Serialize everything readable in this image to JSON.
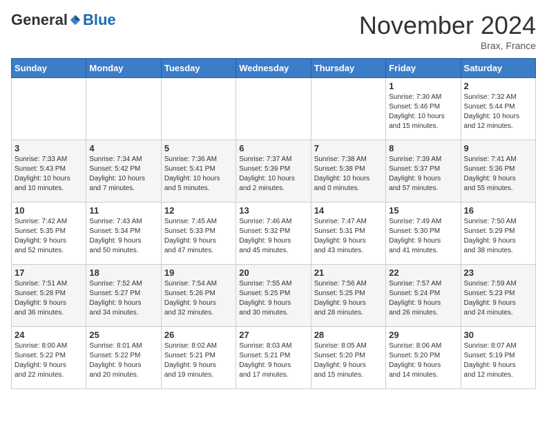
{
  "logo": {
    "general": "General",
    "blue": "Blue"
  },
  "title": "November 2024",
  "location": "Brax, France",
  "days_of_week": [
    "Sunday",
    "Monday",
    "Tuesday",
    "Wednesday",
    "Thursday",
    "Friday",
    "Saturday"
  ],
  "weeks": [
    [
      {
        "day": "",
        "info": ""
      },
      {
        "day": "",
        "info": ""
      },
      {
        "day": "",
        "info": ""
      },
      {
        "day": "",
        "info": ""
      },
      {
        "day": "",
        "info": ""
      },
      {
        "day": "1",
        "info": "Sunrise: 7:30 AM\nSunset: 5:46 PM\nDaylight: 10 hours\nand 15 minutes."
      },
      {
        "day": "2",
        "info": "Sunrise: 7:32 AM\nSunset: 5:44 PM\nDaylight: 10 hours\nand 12 minutes."
      }
    ],
    [
      {
        "day": "3",
        "info": "Sunrise: 7:33 AM\nSunset: 5:43 PM\nDaylight: 10 hours\nand 10 minutes."
      },
      {
        "day": "4",
        "info": "Sunrise: 7:34 AM\nSunset: 5:42 PM\nDaylight: 10 hours\nand 7 minutes."
      },
      {
        "day": "5",
        "info": "Sunrise: 7:36 AM\nSunset: 5:41 PM\nDaylight: 10 hours\nand 5 minutes."
      },
      {
        "day": "6",
        "info": "Sunrise: 7:37 AM\nSunset: 5:39 PM\nDaylight: 10 hours\nand 2 minutes."
      },
      {
        "day": "7",
        "info": "Sunrise: 7:38 AM\nSunset: 5:38 PM\nDaylight: 10 hours\nand 0 minutes."
      },
      {
        "day": "8",
        "info": "Sunrise: 7:39 AM\nSunset: 5:37 PM\nDaylight: 9 hours\nand 57 minutes."
      },
      {
        "day": "9",
        "info": "Sunrise: 7:41 AM\nSunset: 5:36 PM\nDaylight: 9 hours\nand 55 minutes."
      }
    ],
    [
      {
        "day": "10",
        "info": "Sunrise: 7:42 AM\nSunset: 5:35 PM\nDaylight: 9 hours\nand 52 minutes."
      },
      {
        "day": "11",
        "info": "Sunrise: 7:43 AM\nSunset: 5:34 PM\nDaylight: 9 hours\nand 50 minutes."
      },
      {
        "day": "12",
        "info": "Sunrise: 7:45 AM\nSunset: 5:33 PM\nDaylight: 9 hours\nand 47 minutes."
      },
      {
        "day": "13",
        "info": "Sunrise: 7:46 AM\nSunset: 5:32 PM\nDaylight: 9 hours\nand 45 minutes."
      },
      {
        "day": "14",
        "info": "Sunrise: 7:47 AM\nSunset: 5:31 PM\nDaylight: 9 hours\nand 43 minutes."
      },
      {
        "day": "15",
        "info": "Sunrise: 7:49 AM\nSunset: 5:30 PM\nDaylight: 9 hours\nand 41 minutes."
      },
      {
        "day": "16",
        "info": "Sunrise: 7:50 AM\nSunset: 5:29 PM\nDaylight: 9 hours\nand 38 minutes."
      }
    ],
    [
      {
        "day": "17",
        "info": "Sunrise: 7:51 AM\nSunset: 5:28 PM\nDaylight: 9 hours\nand 36 minutes."
      },
      {
        "day": "18",
        "info": "Sunrise: 7:52 AM\nSunset: 5:27 PM\nDaylight: 9 hours\nand 34 minutes."
      },
      {
        "day": "19",
        "info": "Sunrise: 7:54 AM\nSunset: 5:26 PM\nDaylight: 9 hours\nand 32 minutes."
      },
      {
        "day": "20",
        "info": "Sunrise: 7:55 AM\nSunset: 5:25 PM\nDaylight: 9 hours\nand 30 minutes."
      },
      {
        "day": "21",
        "info": "Sunrise: 7:56 AM\nSunset: 5:25 PM\nDaylight: 9 hours\nand 28 minutes."
      },
      {
        "day": "22",
        "info": "Sunrise: 7:57 AM\nSunset: 5:24 PM\nDaylight: 9 hours\nand 26 minutes."
      },
      {
        "day": "23",
        "info": "Sunrise: 7:59 AM\nSunset: 5:23 PM\nDaylight: 9 hours\nand 24 minutes."
      }
    ],
    [
      {
        "day": "24",
        "info": "Sunrise: 8:00 AM\nSunset: 5:22 PM\nDaylight: 9 hours\nand 22 minutes."
      },
      {
        "day": "25",
        "info": "Sunrise: 8:01 AM\nSunset: 5:22 PM\nDaylight: 9 hours\nand 20 minutes."
      },
      {
        "day": "26",
        "info": "Sunrise: 8:02 AM\nSunset: 5:21 PM\nDaylight: 9 hours\nand 19 minutes."
      },
      {
        "day": "27",
        "info": "Sunrise: 8:03 AM\nSunset: 5:21 PM\nDaylight: 9 hours\nand 17 minutes."
      },
      {
        "day": "28",
        "info": "Sunrise: 8:05 AM\nSunset: 5:20 PM\nDaylight: 9 hours\nand 15 minutes."
      },
      {
        "day": "29",
        "info": "Sunrise: 8:06 AM\nSunset: 5:20 PM\nDaylight: 9 hours\nand 14 minutes."
      },
      {
        "day": "30",
        "info": "Sunrise: 8:07 AM\nSunset: 5:19 PM\nDaylight: 9 hours\nand 12 minutes."
      }
    ]
  ]
}
